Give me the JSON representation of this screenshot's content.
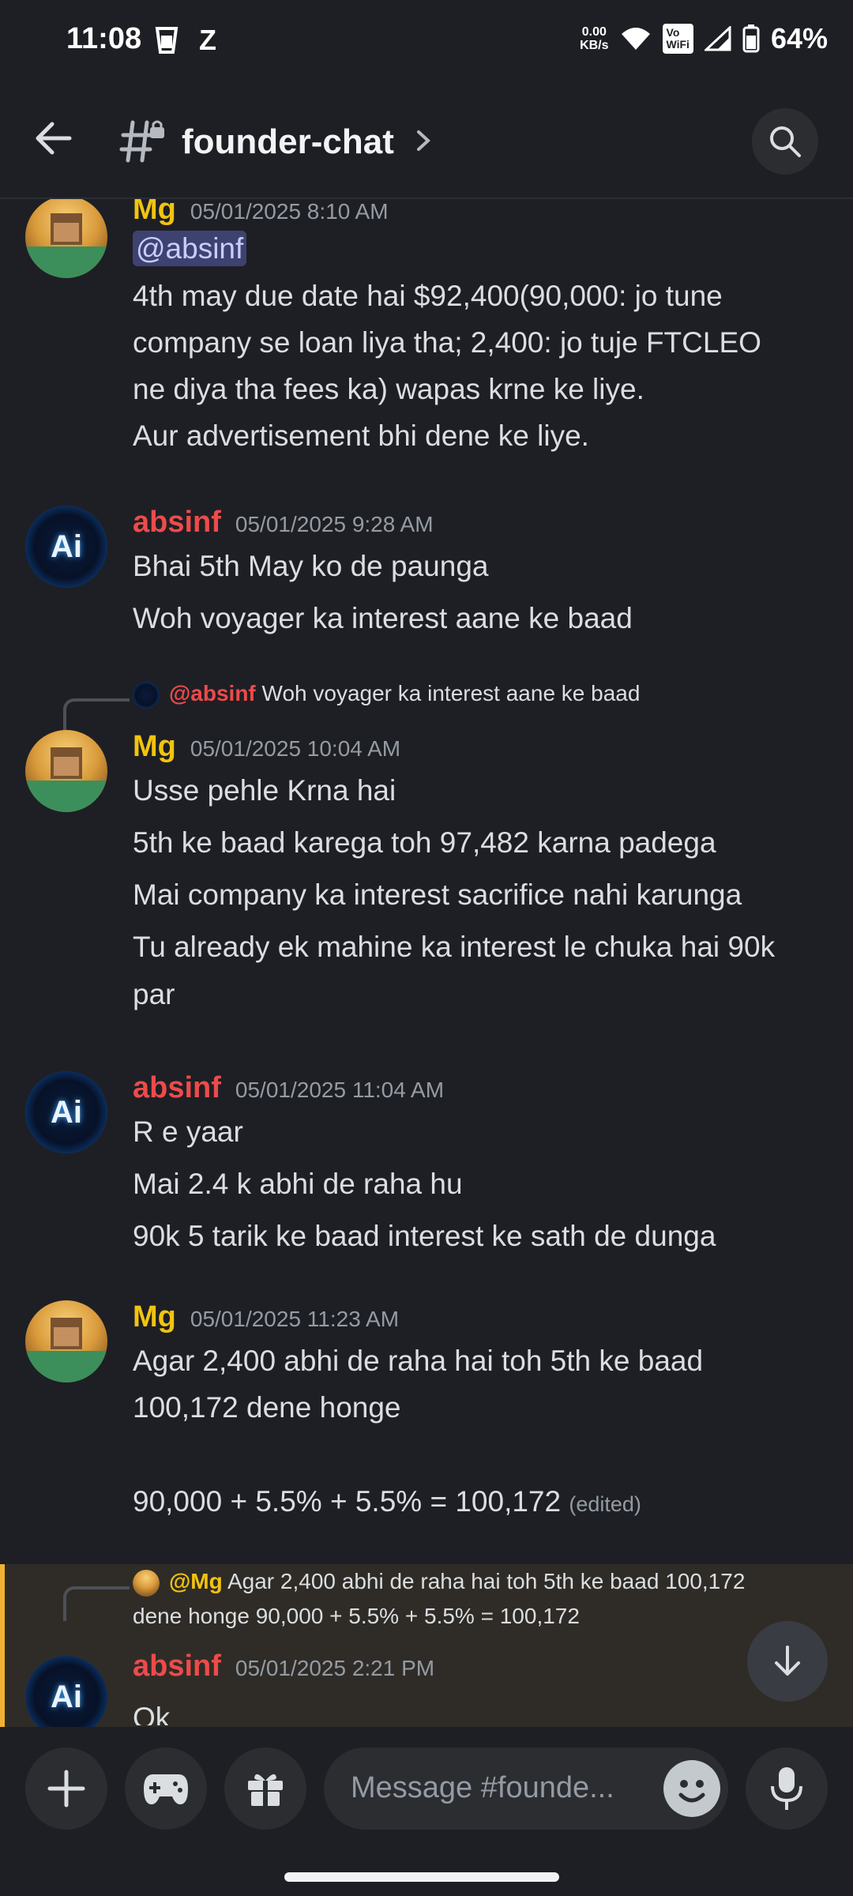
{
  "status_bar": {
    "time": "11:08",
    "net_speed": "0.00",
    "net_unit": "KB/s",
    "wifi_badge_top": "Vo",
    "wifi_badge_bottom": "WiFi",
    "battery": "64%",
    "carrier_glyph": "Z"
  },
  "header": {
    "channel_name": "founder-chat"
  },
  "messages": [
    {
      "author": "Mg",
      "timestamp": "05/01/2025 8:10 AM",
      "mention": "@absinf",
      "lines": [
        "4th may due date hai $92,400(90,000: jo tune",
        "company se loan liya tha; 2,400: jo tuje FTCLEO",
        "ne diya tha fees ka) wapas krne ke liye.",
        "Aur advertisement bhi dene ke liye."
      ]
    },
    {
      "author": "absinf",
      "timestamp": "05/01/2025 9:28 AM",
      "lines": [
        "Bhai 5th May ko de paunga",
        "Woh voyager ka interest aane ke baad"
      ]
    },
    {
      "reply_to_name": "@absinf",
      "reply_to_text": "Woh voyager ka interest aane ke baad",
      "author": "Mg",
      "timestamp": "05/01/2025 10:04 AM",
      "lines": [
        "Usse pehle Krna hai",
        "5th ke baad karega toh 97,482 karna padega",
        "Mai company ka interest sacrifice nahi karunga",
        "Tu already ek mahine ka interest le chuka hai 90k",
        "par"
      ]
    },
    {
      "author": "absinf",
      "timestamp": "05/01/2025 11:04 AM",
      "lines": [
        "R e yaar",
        "Mai 2.4 k abhi de raha hu",
        "90k 5 tarik ke baad interest ke sath de dunga"
      ]
    },
    {
      "author": "Mg",
      "timestamp": "05/01/2025 11:23 AM",
      "lines": [
        "Agar 2,400 abhi de raha hai toh 5th ke baad",
        "100,172 dene honge",
        "90,000 + 5.5% + 5.5% = 100,172"
      ],
      "edited": "(edited)"
    },
    {
      "reply_to_name": "@Mg",
      "reply_to_text_1": "Agar 2,400 abhi de raha hai toh 5th ke baad 100,172",
      "reply_to_text_2": "dene honge  90,000 + 5.5% + 5.5% = 100,172",
      "author": "absinf",
      "timestamp": "05/01/2025 2:21 PM",
      "lines": [
        "Ok"
      ]
    }
  ],
  "composer": {
    "placeholder": "Message #founde..."
  },
  "avatars": {
    "mg_text": "",
    "ai_text": "Ai"
  },
  "icons": [
    "back-arrow-icon",
    "hashtag-lock-icon",
    "chevron-right-icon",
    "search-icon",
    "plus-icon",
    "gamepad-icon",
    "gift-icon",
    "emoji-icon",
    "microphone-icon",
    "arrow-down-icon"
  ]
}
